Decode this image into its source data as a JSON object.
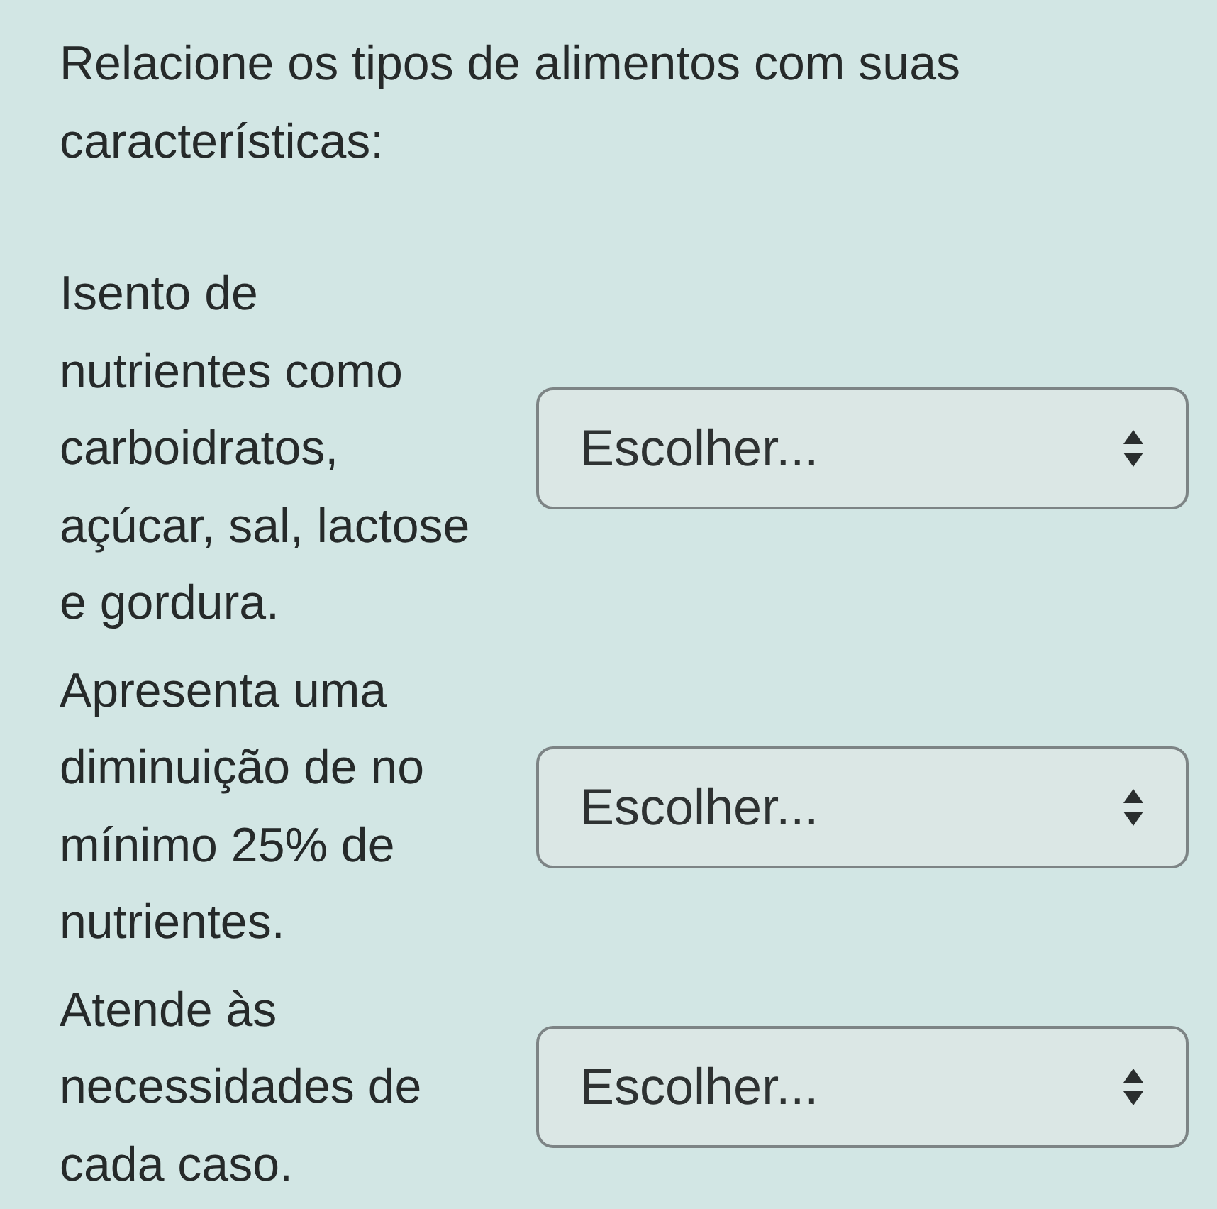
{
  "question": {
    "prompt": "Relacione os tipos de alimentos com suas características:"
  },
  "rows": [
    {
      "statement": "Isento de nutrientes como carboidratos, açúcar, sal, lactose e gordura.",
      "dropdown": {
        "value": "Escolher..."
      }
    },
    {
      "statement": "Apresenta uma diminuição de no mínimo 25% de nutrientes.",
      "dropdown": {
        "value": "Escolher..."
      }
    },
    {
      "statement": "Atende às necessidades de cada caso.",
      "dropdown": {
        "value": "Escolher..."
      }
    }
  ]
}
